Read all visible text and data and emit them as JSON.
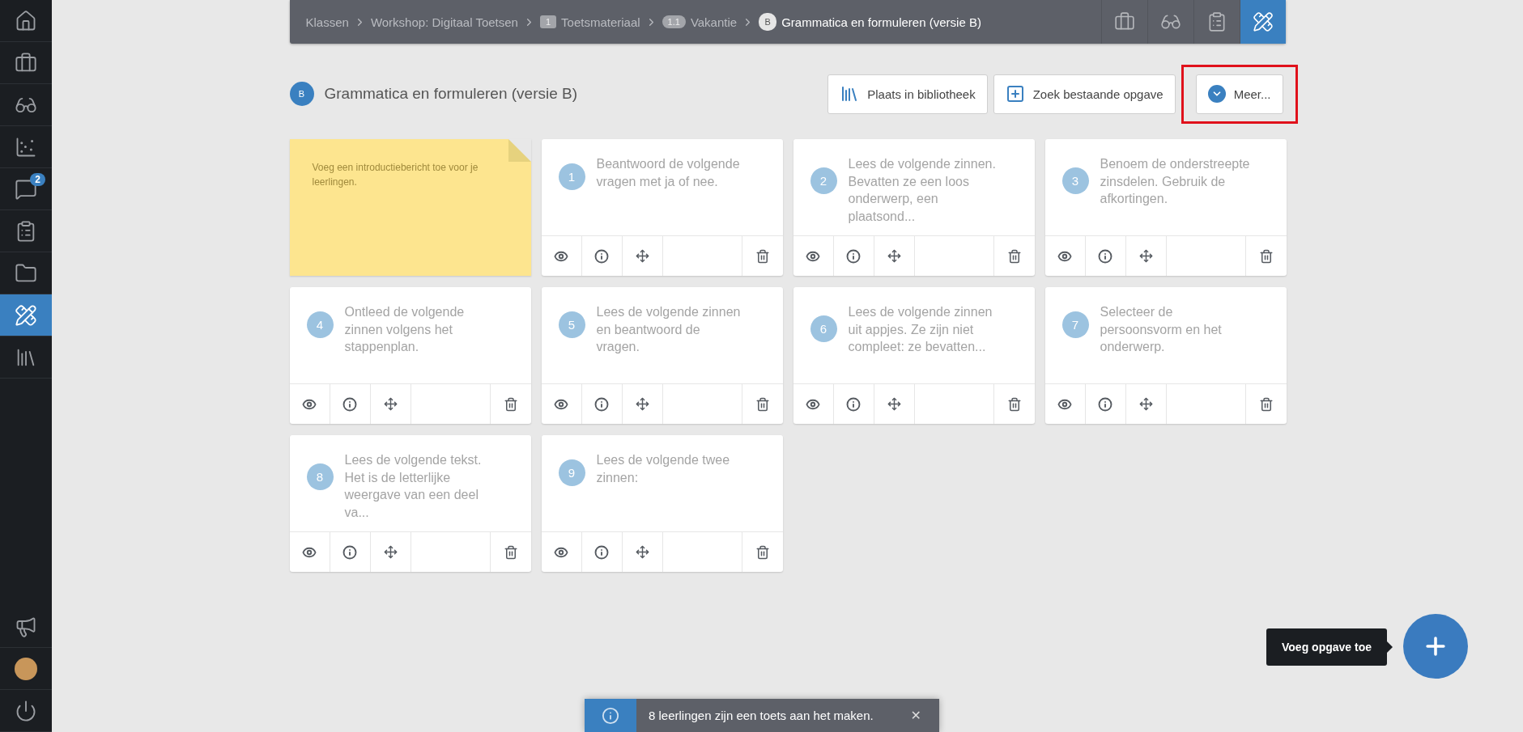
{
  "sidebar": {
    "items": [
      {
        "selected": false
      },
      {
        "selected": false
      },
      {
        "selected": false
      },
      {
        "selected": false
      },
      {
        "selected": false,
        "badge": "2"
      },
      {
        "selected": false
      },
      {
        "selected": false
      },
      {
        "selected": true
      },
      {
        "selected": false
      }
    ],
    "bottom_items": [
      {
        "kind": "icon"
      },
      {
        "kind": "avatar"
      },
      {
        "kind": "icon"
      }
    ]
  },
  "breadcrumb": {
    "items": [
      {
        "label": "Klassen",
        "current": false
      },
      {
        "label": "Workshop: Digitaal Toetsen",
        "current": false
      },
      {
        "label": "Toetsmateriaal",
        "badge": "1",
        "kind": "square",
        "current": false
      },
      {
        "label": "Vakantie",
        "badge": "1.1",
        "kind": "pill",
        "current": false
      },
      {
        "label": "Grammatica en formuleren (versie B)",
        "badge": "B",
        "kind": "circle",
        "current": true
      }
    ],
    "tools": [
      {
        "selected": false
      },
      {
        "selected": false
      },
      {
        "selected": false
      },
      {
        "selected": true
      }
    ]
  },
  "header": {
    "badge": "B",
    "title": "Grammatica en formuleren (versie B)",
    "buttons": [
      {
        "label": "Plaats in bibliotheek",
        "highlighted": false
      },
      {
        "label": "Zoek bestaande opgave",
        "highlighted": false
      },
      {
        "label": "Meer...",
        "highlighted": true
      }
    ]
  },
  "note": {
    "text": "Voeg een introductiebericht toe voor je leerlingen."
  },
  "questions": [
    {
      "number": "1",
      "text": "Beantwoord de volgende vragen met ja of nee."
    },
    {
      "number": "2",
      "text": "Lees de volgende zinnen. Bevatten ze een loos onderwerp, een plaatsond..."
    },
    {
      "number": "3",
      "text": "Benoem de onderstreepte zinsdelen. Gebruik de afkortingen."
    },
    {
      "number": "4",
      "text": "Ontleed de volgende zinnen volgens het stappenplan."
    },
    {
      "number": "5",
      "text": "Lees de volgende zinnen en beantwoord de vragen."
    },
    {
      "number": "6",
      "text": "Lees de volgende zinnen uit appjes. Ze zijn niet compleet: ze bevatten..."
    },
    {
      "number": "7",
      "text": "Selecteer de persoonsvorm en het onderwerp."
    },
    {
      "number": "8",
      "text": "Lees de volgende tekst. Het is de letterlijke weergave van een deel va..."
    },
    {
      "number": "9",
      "text": "Lees de volgende twee zinnen:"
    }
  ],
  "add_button": {
    "tooltip": "Voeg opgave toe"
  },
  "toast": {
    "message": "8 leerlingen zijn een toets aan het maken.",
    "close": "✕"
  }
}
